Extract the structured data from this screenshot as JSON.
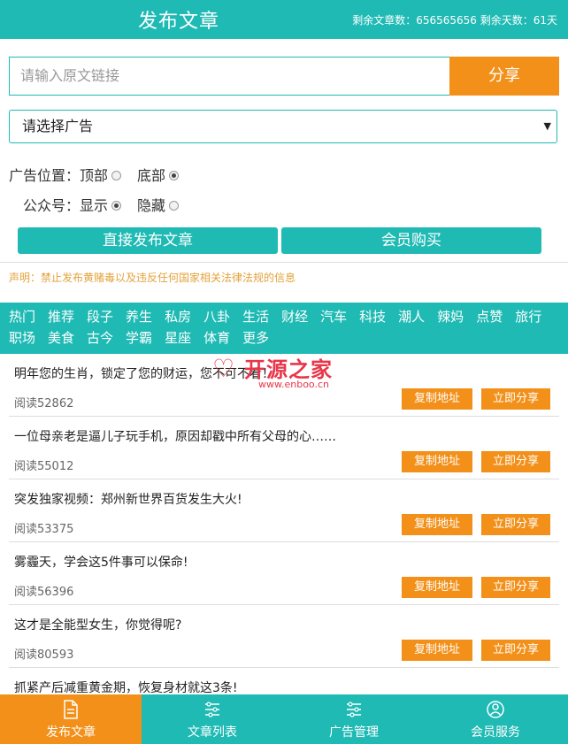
{
  "header": {
    "title": "发布文章",
    "stats": "剩余文章数：656565656  剩余天数：61天"
  },
  "share": {
    "placeholder": "请输入原文链接",
    "button": "分享"
  },
  "ad_select": {
    "value": "请选择广告"
  },
  "ad_position": {
    "label": "广告位置：",
    "top": "顶部",
    "bottom": "底部",
    "selected": "底部"
  },
  "official_account": {
    "label": "公众号：",
    "show": "显示",
    "hide": "隐藏",
    "selected": "显示"
  },
  "buttons": {
    "publish": "直接发布文章",
    "buy": "会员购买"
  },
  "notice": "声明：禁止发布黄赌毒以及违反任何国家相关法律法规的信息",
  "categories": [
    "热门",
    "推荐",
    "段子",
    "养生",
    "私房",
    "八卦",
    "生活",
    "财经",
    "汽车",
    "科技",
    "潮人",
    "辣妈",
    "点赞",
    "旅行",
    "职场",
    "美食",
    "古今",
    "学霸",
    "星座",
    "体育",
    "更多"
  ],
  "articles": [
    {
      "title": "明年您的生肖，锁定了您的财运，您不可不看！",
      "reads": "阅读52862"
    },
    {
      "title": "一位母亲老是逼儿子玩手机，原因却戳中所有父母的心……",
      "reads": "阅读55012"
    },
    {
      "title": "突发独家视频：郑州新世界百货发生大火!",
      "reads": "阅读53375"
    },
    {
      "title": "雾霾天，学会这5件事可以保命!",
      "reads": "阅读56396"
    },
    {
      "title": "这才是全能型女生，你觉得呢?",
      "reads": "阅读80593"
    },
    {
      "title": "抓紧产后减重黄金期，恢复身材就这3条!",
      "reads": ""
    }
  ],
  "article_actions": {
    "copy": "复制地址",
    "share": "立即分享"
  },
  "watermark": {
    "name": "开源之家",
    "url": "www.enboo.cn"
  },
  "tabs": [
    {
      "label": "发布文章",
      "icon": "document-icon"
    },
    {
      "label": "文章列表",
      "icon": "list-icon"
    },
    {
      "label": "广告管理",
      "icon": "list-icon"
    },
    {
      "label": "会员服务",
      "icon": "user-icon"
    }
  ],
  "colors": {
    "teal": "#1fbab4",
    "orange": "#f29019",
    "notice": "#e2a23a"
  }
}
